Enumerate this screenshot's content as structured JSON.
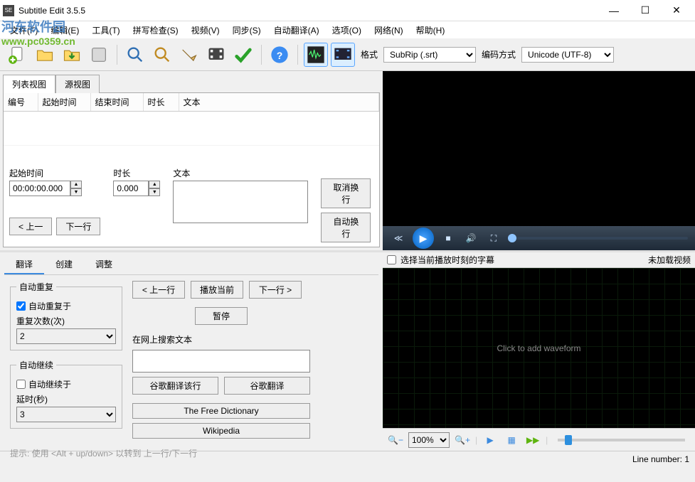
{
  "window": {
    "title": "Subtitle Edit 3.5.5"
  },
  "watermark": {
    "line1": "河东软件园",
    "line2": "www.pc0359.cn"
  },
  "menu": {
    "file": "文件(F)",
    "edit": "编辑(E)",
    "tools": "工具(T)",
    "spell": "拼写检查(S)",
    "video": "视频(V)",
    "sync": "同步(S)",
    "autotrans": "自动翻译(A)",
    "options": "选项(O)",
    "net": "网络(N)",
    "help": "帮助(H)"
  },
  "toolbar": {
    "format_label": "格式",
    "format_value": "SubRip (.srt)",
    "encoding_label": "编码方式",
    "encoding_value": "Unicode (UTF-8)"
  },
  "tabs": {
    "list": "列表视图",
    "source": "源视图"
  },
  "grid": {
    "col_num": "编号",
    "col_start": "起始时间",
    "col_end": "结束时间",
    "col_dur": "时长",
    "col_text": "文本"
  },
  "edit": {
    "start_label": "起始时间",
    "start_value": "00:00:00.000",
    "dur_label": "时长",
    "dur_value": "0.000",
    "text_label": "文本",
    "unbreak": "取消换行",
    "autobreak": "自动换行",
    "prev": "< 上一",
    "next": "下一行"
  },
  "panel": {
    "tab_translate": "翻译",
    "tab_create": "创建",
    "tab_adjust": "调整",
    "autorepeat_legend": "自动重复",
    "autorepeat_chk": "自动重复于",
    "repeat_times_label": "重复次数(次)",
    "repeat_times_value": "2",
    "autocontinue_legend": "自动继续",
    "autocontinue_chk": "自动继续于",
    "delay_label": "延时(秒)",
    "delay_value": "3",
    "prev": "< 上一行",
    "play_current": "播放当前",
    "next": "下一行 >",
    "pause": "暂停",
    "search_label": "在网上搜索文本",
    "google_line": "谷歌翻译该行",
    "google": "谷歌翻译",
    "free_dict": "The Free Dictionary",
    "wiki": "Wikipedia",
    "tip": "提示: 使用 <Alt + up/down> 以转到 上一行/下一行"
  },
  "wave": {
    "checkbox_label": "选择当前播放时刻的字幕",
    "novideo": "未加载视频",
    "placeholder": "Click to add waveform",
    "zoom": "100%"
  },
  "status": {
    "line_number": "Line number: 1"
  }
}
